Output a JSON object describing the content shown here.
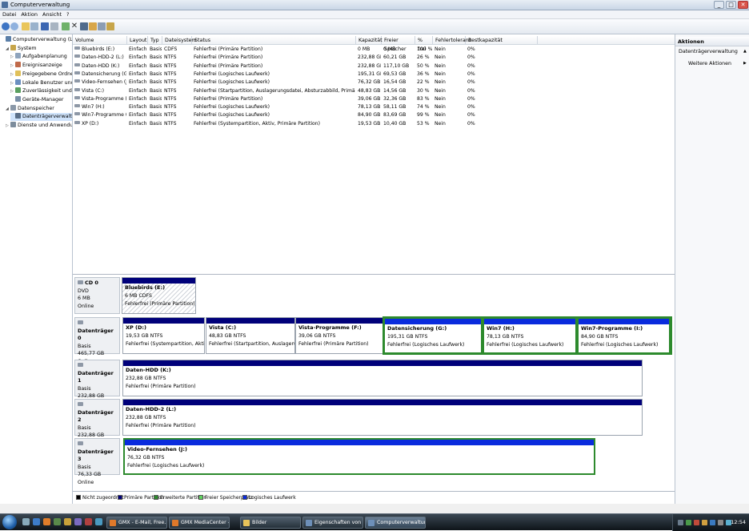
{
  "window": {
    "title": "Computerverwaltung",
    "min": "_",
    "max": "□",
    "close": "✕"
  },
  "menu": [
    "Datei",
    "Aktion",
    "Ansicht",
    "?"
  ],
  "tree": [
    {
      "label": "Computerverwaltung (Lokal)",
      "expander": "",
      "icon": "computer-icon",
      "indent": 0
    },
    {
      "label": "System",
      "expander": "◢",
      "icon": "system-tools-icon",
      "indent": 1
    },
    {
      "label": "Aufgabenplanung",
      "expander": "▷",
      "icon": "task-scheduler-icon",
      "indent": 2
    },
    {
      "label": "Ereignisanzeige",
      "expander": "▷",
      "icon": "event-viewer-icon",
      "indent": 2
    },
    {
      "label": "Freigegebene Ordner",
      "expander": "▷",
      "icon": "shared-folder-icon",
      "indent": 2
    },
    {
      "label": "Lokale Benutzer und Gruppen",
      "expander": "▷",
      "icon": "users-icon",
      "indent": 2
    },
    {
      "label": "Zuverlässigkeit und Leistung",
      "expander": "▷",
      "icon": "performance-icon",
      "indent": 2
    },
    {
      "label": "Geräte-Manager",
      "expander": "",
      "icon": "device-manager-icon",
      "indent": 2
    },
    {
      "label": "Datenspeicher",
      "expander": "◢",
      "icon": "storage-icon",
      "indent": 1
    },
    {
      "label": "Datenträgerverwaltung",
      "expander": "",
      "icon": "disk-management-icon",
      "indent": 2,
      "selected": true
    },
    {
      "label": "Dienste und Anwendungen",
      "expander": "▷",
      "icon": "services-icon",
      "indent": 1
    }
  ],
  "volume_table": {
    "headers": [
      "Volume",
      "Layout",
      "Typ",
      "Dateisystem",
      "Status",
      "Kapazität",
      "Freier Speicher",
      "% frei",
      "Fehlertoleranz",
      "Restkapazität"
    ],
    "rows": [
      [
        "Bluebirds (E:)",
        "Einfach",
        "Basis",
        "CDFS",
        "Fehlerfrei (Primäre Partition)",
        "0 MB",
        "0 MB",
        "100 %",
        "Nein",
        "0%"
      ],
      [
        "Daten-HDD-2 (L:)",
        "Einfach",
        "Basis",
        "NTFS",
        "Fehlerfrei (Primäre Partition)",
        "232,88 GB",
        "60,21 GB",
        "26 %",
        "Nein",
        "0%"
      ],
      [
        "Daten-HDD (K:)",
        "Einfach",
        "Basis",
        "NTFS",
        "Fehlerfrei (Primäre Partition)",
        "232,88 GB",
        "117,10 GB",
        "50 %",
        "Nein",
        "0%"
      ],
      [
        "Datensicherung (G:)",
        "Einfach",
        "Basis",
        "NTFS",
        "Fehlerfrei (Logisches Laufwerk)",
        "195,31 GB",
        "69,53 GB",
        "36 %",
        "Nein",
        "0%"
      ],
      [
        "Video-Fernsehen (J:)",
        "Einfach",
        "Basis",
        "NTFS",
        "Fehlerfrei (Logisches Laufwerk)",
        "76,32 GB",
        "16,54 GB",
        "22 %",
        "Nein",
        "0%"
      ],
      [
        "Vista (C:)",
        "Einfach",
        "Basis",
        "NTFS",
        "Fehlerfrei (Startpartition, Auslagerungsdatei, Absturzabbild, Primäre Partition)",
        "48,83 GB",
        "14,56 GB",
        "30 %",
        "Nein",
        "0%"
      ],
      [
        "Vista-Programme (F:)",
        "Einfach",
        "Basis",
        "NTFS",
        "Fehlerfrei (Primäre Partition)",
        "39,06 GB",
        "32,36 GB",
        "83 %",
        "Nein",
        "0%"
      ],
      [
        "Win7 (H:)",
        "Einfach",
        "Basis",
        "NTFS",
        "Fehlerfrei (Logisches Laufwerk)",
        "78,13 GB",
        "58,11 GB",
        "74 %",
        "Nein",
        "0%"
      ],
      [
        "Win7-Programme (I:)",
        "Einfach",
        "Basis",
        "NTFS",
        "Fehlerfrei (Logisches Laufwerk)",
        "84,90 GB",
        "83,69 GB",
        "99 %",
        "Nein",
        "0%"
      ],
      [
        "XP (D:)",
        "Einfach",
        "Basis",
        "NTFS",
        "Fehlerfrei (Systempartition, Aktiv, Primäre Partition)",
        "19,53 GB",
        "10,40 GB",
        "53 %",
        "Nein",
        "0%"
      ]
    ]
  },
  "disks": [
    {
      "name": "CD 0",
      "line1": "DVD",
      "line2": "6 MB",
      "line3": "Online",
      "partitions": [
        {
          "name": "Bluebirds (E:)",
          "size": "6 MB CDFS",
          "status": "Fehlerfrei (Primäre Partition)",
          "kind": "cd"
        }
      ]
    },
    {
      "name": "Datenträger 0",
      "line1": "Basis",
      "line2": "465,77 GB",
      "line3": "Online",
      "partitions": [
        {
          "name": "XP (D:)",
          "size": "19,53 GB NTFS",
          "status": "Fehlerfrei (Systempartition, Aktiv, Pri",
          "kind": "primary"
        },
        {
          "name": "Vista (C:)",
          "size": "48,83 GB NTFS",
          "status": "Fehlerfrei (Startpartition, Auslagerungsdi",
          "kind": "primary"
        },
        {
          "name": "Vista-Programme (F:)",
          "size": "39,06 GB NTFS",
          "status": "Fehlerfrei (Primäre Partition)",
          "kind": "primary"
        },
        {
          "name": "Datensicherung (G:)",
          "size": "195,31 GB NTFS",
          "status": "Fehlerfrei (Logisches Laufwerk)",
          "kind": "logical"
        },
        {
          "name": "Win7 (H:)",
          "size": "78,13 GB NTFS",
          "status": "Fehlerfrei (Logisches Laufwerk)",
          "kind": "logical"
        },
        {
          "name": "Win7-Programme (I:)",
          "size": "84,90 GB NTFS",
          "status": "Fehlerfrei (Logisches Laufwerk)",
          "kind": "logical"
        }
      ]
    },
    {
      "name": "Datenträger 1",
      "line1": "Basis",
      "line2": "232,88 GB",
      "line3": "Online",
      "partitions": [
        {
          "name": "Daten-HDD (K:)",
          "size": "232,88 GB NTFS",
          "status": "Fehlerfrei (Primäre Partition)",
          "kind": "primary"
        }
      ]
    },
    {
      "name": "Datenträger 2",
      "line1": "Basis",
      "line2": "232,88 GB",
      "line3": "Online",
      "partitions": [
        {
          "name": "Daten-HDD-2 (L:)",
          "size": "232,88 GB NTFS",
          "status": "Fehlerfrei (Primäre Partition)",
          "kind": "primary"
        }
      ]
    },
    {
      "name": "Datenträger 3",
      "line1": "Basis",
      "line2": "76,33 GB",
      "line3": "Online",
      "partitions": [
        {
          "name": "Video-Fernsehen (J:)",
          "size": "76,32 GB NTFS",
          "status": "Fehlerfrei (Logisches Laufwerk)",
          "kind": "logical"
        }
      ]
    }
  ],
  "legend": [
    {
      "label": "Nicht zugeordnet",
      "color": "#000000"
    },
    {
      "label": "Primäre Partition",
      "color": "#00007a"
    },
    {
      "label": "Erweiterte Partition",
      "color": "#2d8a2d"
    },
    {
      "label": "Freier Speicherplatz",
      "color": "#5ed35e"
    },
    {
      "label": "Logisches Laufwerk",
      "color": "#0a2bdd"
    }
  ],
  "actions": {
    "header": "Aktionen",
    "section": "Datenträgerverwaltung",
    "item": "Weitere Aktionen",
    "arrow": "▶",
    "section_arrow": "▲"
  },
  "taskbar": {
    "buttons": [
      {
        "label": "GMX - E-Mail, Free...",
        "icon_color": "#e0792a"
      },
      {
        "label": "GMX MediaCenter - ...",
        "icon_color": "#e0792a"
      },
      {
        "label": "Bilder",
        "icon_color": "#e8c35a"
      },
      {
        "label": "Eigenschaften von F...",
        "icon_color": "#6d8fb8"
      },
      {
        "label": "Computerverwaltung",
        "icon_color": "#6d8fb8",
        "active": true
      }
    ],
    "clock": "12:54"
  }
}
